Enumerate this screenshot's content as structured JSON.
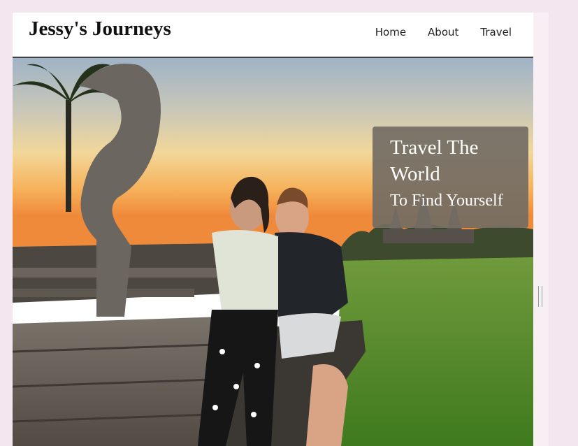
{
  "site": {
    "title": "Jessy's Journeys"
  },
  "nav": {
    "items": [
      {
        "label": "Home"
      },
      {
        "label": "About"
      },
      {
        "label": "Travel"
      }
    ]
  },
  "hero": {
    "image_icon": "hero-photo-couple-at-temple-sunset",
    "tagline_line1": "Travel The World",
    "tagline_line2": "To Find Yourself"
  },
  "colors": {
    "page_background": "#f3e6ee",
    "header_background": "#ffffff",
    "header_border": "#444444",
    "tagline_box": "#736c64",
    "tagline_text": "#ffffff"
  }
}
